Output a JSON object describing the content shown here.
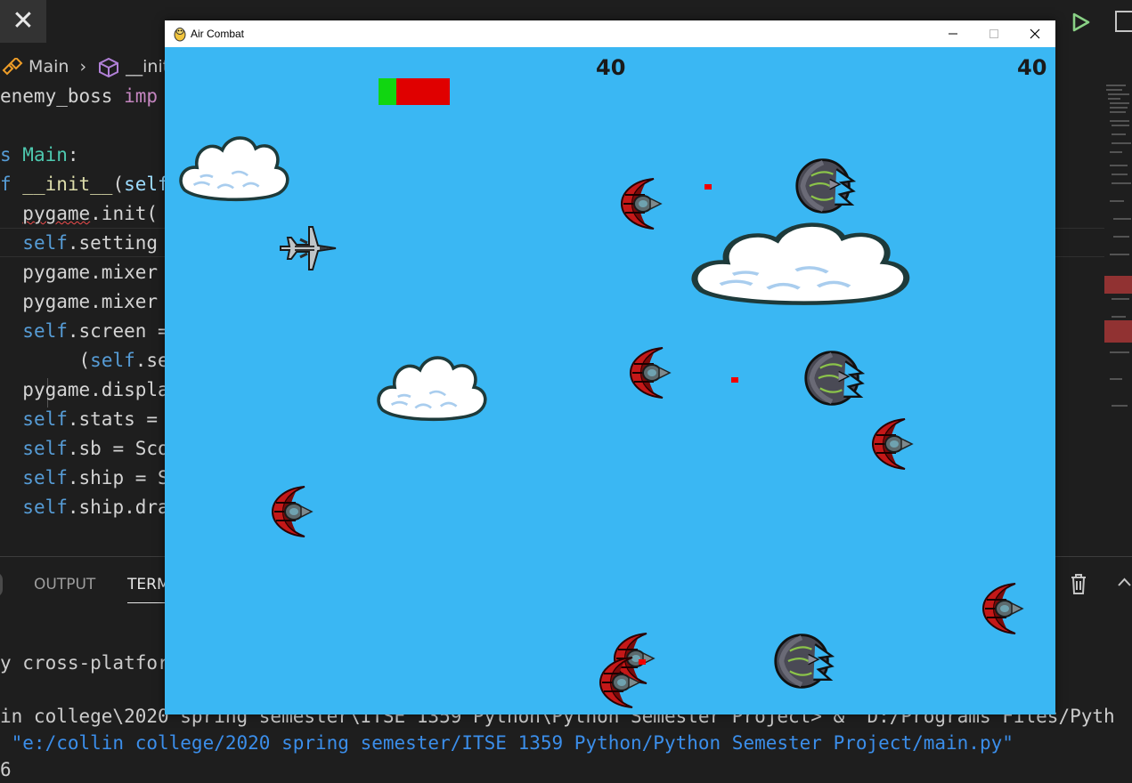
{
  "editor": {
    "breadcrumb": [
      "Main",
      "__init"
    ],
    "code_lines": [
      {
        "indent": "",
        "tokens": [
          {
            "t": "enemy_boss ",
            "c": ""
          },
          {
            "t": "imp",
            "c": "imp"
          }
        ]
      },
      {
        "indent": "",
        "tokens": []
      },
      {
        "indent": "",
        "tokens": [
          {
            "t": "s ",
            "c": "kw"
          },
          {
            "t": "Main",
            "c": "cls"
          },
          {
            "t": ":",
            "c": ""
          }
        ]
      },
      {
        "indent": "",
        "tokens": [
          {
            "t": "f ",
            "c": "kw"
          },
          {
            "t": "__init__",
            "c": "fn"
          },
          {
            "t": "(",
            "c": ""
          },
          {
            "t": "self",
            "c": "var"
          }
        ]
      },
      {
        "indent": "  ",
        "tokens": [
          {
            "t": "pygame",
            "c": "squig"
          },
          {
            "t": ".init(",
            "c": ""
          }
        ]
      },
      {
        "indent": "  ",
        "tokens": [
          {
            "t": "self",
            "c": "self"
          },
          {
            "t": ".setting",
            "c": ""
          }
        ]
      },
      {
        "indent": "  ",
        "tokens": [
          {
            "t": "pygame.mixer",
            "c": ""
          }
        ]
      },
      {
        "indent": "  ",
        "tokens": [
          {
            "t": "pygame.mixer",
            "c": ""
          }
        ]
      },
      {
        "indent": "  ",
        "tokens": [
          {
            "t": "self",
            "c": "self"
          },
          {
            "t": ".screen =",
            "c": ""
          }
        ]
      },
      {
        "indent": "       ",
        "tokens": [
          {
            "t": "(",
            "c": ""
          },
          {
            "t": "self",
            "c": "self"
          },
          {
            "t": ".set",
            "c": ""
          }
        ]
      },
      {
        "indent": "  ",
        "tokens": [
          {
            "t": "pygame.displa",
            "c": ""
          }
        ]
      },
      {
        "indent": "  ",
        "tokens": [
          {
            "t": "self",
            "c": "self"
          },
          {
            "t": ".stats =",
            "c": ""
          }
        ]
      },
      {
        "indent": "  ",
        "tokens": [
          {
            "t": "self",
            "c": "self"
          },
          {
            "t": ".sb = Sco",
            "c": ""
          }
        ]
      },
      {
        "indent": "  ",
        "tokens": [
          {
            "t": "self",
            "c": "self"
          },
          {
            "t": ".ship = S",
            "c": ""
          }
        ]
      },
      {
        "indent": "  ",
        "tokens": [
          {
            "t": "self",
            "c": "self"
          },
          {
            "t": ".ship.dra",
            "c": ""
          }
        ]
      }
    ],
    "panel_tabs": [
      "OUTPUT",
      "TERM"
    ],
    "terminal_lines": [
      {
        "text": "y cross-platfor",
        "cls": ""
      },
      {
        "text": "in college\\2020 spring semester\\ITSE 1359 Python\\Python Semester Project> &  D:/Programs Files/Pyth",
        "cls": "mixed"
      },
      {
        "text": " \"e:/collin college/2020 spring semester/ITSE 1359 Python/Python Semester Project/main.py\"",
        "cls": "path"
      },
      {
        "text": "6",
        "cls": ""
      }
    ]
  },
  "window": {
    "title": "Air Combat",
    "buttons": [
      "minimize",
      "maximize",
      "close"
    ]
  },
  "game": {
    "score_center": "40",
    "score_right": "40",
    "health_fraction": 0.25,
    "colors": {
      "sky": "#3ab7f3",
      "health_good": "#11d611",
      "health_bad": "#e00000",
      "bullet": "#f00000"
    },
    "sprites": [
      "cloud",
      "cloud",
      "cloud",
      "player-jet",
      "red-crescent-ship",
      "red-crescent-ship",
      "red-crescent-ship",
      "red-crescent-ship",
      "red-crescent-ship",
      "red-crescent-ship",
      "red-crescent-ship",
      "dark-boss-ship",
      "dark-boss-ship",
      "dark-boss-ship",
      "enemy-bullet",
      "enemy-bullet",
      "enemy-bullet"
    ]
  }
}
